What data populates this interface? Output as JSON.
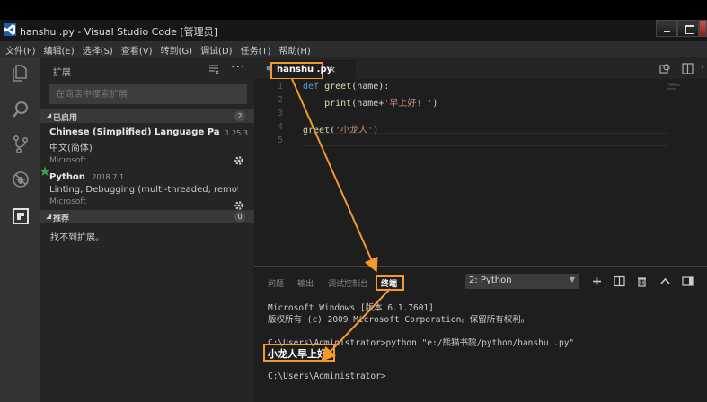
{
  "window": {
    "title": "hanshu .py - Visual Studio Code [管理员]"
  },
  "menubar": {
    "items": [
      "文件(F)",
      "编辑(E)",
      "选择(S)",
      "查看(V)",
      "转到(G)",
      "调试(D)",
      "任务(T)",
      "帮助(H)"
    ]
  },
  "activitybar": {
    "icons": [
      "files-icon",
      "search-icon",
      "source-control-icon",
      "debug-icon",
      "extensions-icon"
    ]
  },
  "sidebar": {
    "title": "扩展",
    "search_placeholder": "在商店中搜索扩展",
    "enabled": {
      "label": "已启用",
      "count": "2",
      "extensions": [
        {
          "name": "Chinese (Simplified) Language Pack f...",
          "version": "1.25.3",
          "description": "中文(简体)",
          "publisher": "Microsoft"
        },
        {
          "name": "Python",
          "version": "2018.7.1",
          "description": "Linting, Debugging (multi-threaded, remote), I...",
          "publisher": "Microsoft"
        }
      ]
    },
    "recommended": {
      "label": "推荐",
      "count": "0",
      "empty_text": "找不到扩展。"
    }
  },
  "editor": {
    "tab": {
      "label": "hanshu .py",
      "close": "×"
    },
    "lines": [
      {
        "number": "1",
        "kw": "def ",
        "fn": "greet",
        "rest": "(name):",
        "str": "",
        "end": ""
      },
      {
        "number": "2",
        "kw": "",
        "fn": "    print",
        "rest": "(name+",
        "str": "'早上好! '",
        "end": ")"
      },
      {
        "number": "3",
        "kw": "",
        "fn": "",
        "rest": "",
        "str": "",
        "end": ""
      },
      {
        "number": "4",
        "kw": "",
        "fn": "greet",
        "rest": "(",
        "str": "'小龙人'",
        "end": ")"
      },
      {
        "number": "5",
        "kw": "",
        "fn": "",
        "rest": "",
        "str": "",
        "end": ""
      }
    ]
  },
  "panel": {
    "tabs": [
      "问题",
      "输出",
      "调试控制台",
      "终端"
    ],
    "active_tab": "终端",
    "terminal_select": "2: Python",
    "terminal_lines": [
      "Microsoft Windows [版本 6.1.7601]",
      "版权所有 (c) 2009 Microsoft Corporation。保留所有权利。",
      "C:\\Users\\Administrator>python \"e:/熊猫书院/python/hanshu .py\"",
      "C:\\Users\\Administrator>"
    ],
    "terminal_output": "小龙人早上好!"
  },
  "colors": {
    "annotation": "#f39a2b",
    "activitybar": "#333333",
    "sidebar": "#252526",
    "editor": "#1e1e1e"
  }
}
